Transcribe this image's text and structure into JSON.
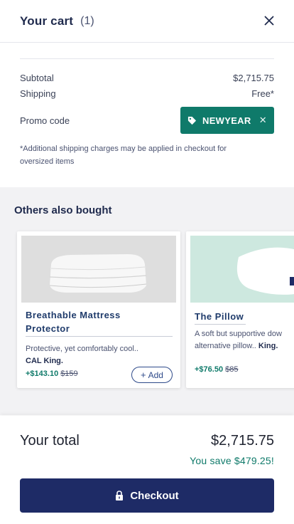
{
  "header": {
    "title": "Your cart",
    "count": "(1)"
  },
  "summary": {
    "subtotal_label": "Subtotal",
    "subtotal_value": "$2,715.75",
    "shipping_label": "Shipping",
    "shipping_value": "Free*",
    "promo_label": "Promo code",
    "promo_code": "NEWYEAR",
    "note": "*Additional shipping charges may be applied in checkout for oversized items"
  },
  "recommendations": {
    "heading": "Others also bought",
    "items": [
      {
        "name": "Breathable Mattress Protector",
        "desc": "Protective, yet comfortably cool..",
        "desc_bold": "CAL King.",
        "price_now": "+$143.10",
        "price_was": "$159",
        "add_label": "Add"
      },
      {
        "name": "The Pillow",
        "desc_line1": "A soft but supportive dow",
        "desc_line2": "alternative pillow..",
        "desc_bold": "King.",
        "price_now": "+$76.50",
        "price_was": "$85"
      }
    ]
  },
  "total": {
    "label": "Your total",
    "value": "$2,715.75",
    "savings": "You save $479.25!",
    "checkout_label": "Checkout"
  },
  "colors": {
    "navy": "#1e2b66",
    "teal": "#0f7a6a"
  },
  "icons": [
    "close-icon",
    "tag-icon",
    "lock-icon",
    "plus-icon"
  ]
}
